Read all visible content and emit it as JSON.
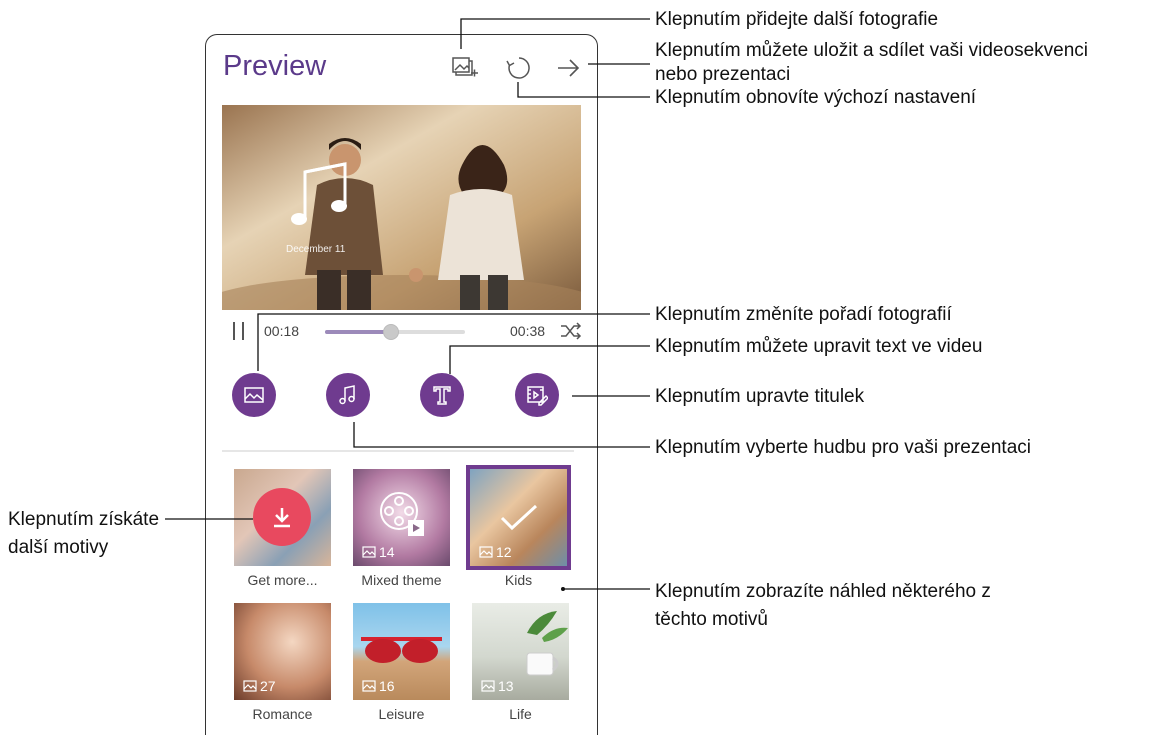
{
  "app": {
    "title": "Preview"
  },
  "photo": {
    "caption": "December 11"
  },
  "player": {
    "current_time": "00:18",
    "total_time": "00:38",
    "progress": 0.47
  },
  "tools": [
    {
      "name": "photo-order",
      "icon": "image-icon"
    },
    {
      "name": "music",
      "icon": "music-note-icon"
    },
    {
      "name": "text",
      "icon": "text-icon"
    },
    {
      "name": "title",
      "icon": "film-edit-icon"
    }
  ],
  "themes": [
    {
      "label": "Get more...",
      "count": ""
    },
    {
      "label": "Mixed theme",
      "count": "14"
    },
    {
      "label": "Kids",
      "count": "12",
      "selected": true
    },
    {
      "label": "Romance",
      "count": "27"
    },
    {
      "label": "Leisure",
      "count": "16"
    },
    {
      "label": "Life",
      "count": "13"
    }
  ],
  "callouts": {
    "add_photos": "Klepnutím přidejte další fotografie",
    "save_share_1": "Klepnutím můžete uložit a sdílet vaši videosekvenci",
    "save_share_2": "nebo prezentaci",
    "reset": "Klepnutím obnovíte výchozí nastavení",
    "reorder": "Klepnutím změníte pořadí fotografií",
    "edit_text": "Klepnutím můžete upravit text ve videu",
    "edit_title": "Klepnutím upravte titulek",
    "music": "Klepnutím vyberte hudbu pro vaši prezentaci",
    "more_themes_1": "Klepnutím získáte",
    "more_themes_2": "další motivy",
    "preview_theme_1": "Klepnutím zobrazíte náhled některého z",
    "preview_theme_2": "těchto motivů"
  },
  "colors": {
    "accent": "#6f3b8f",
    "title": "#5b3a8a",
    "download": "#e8495f"
  }
}
